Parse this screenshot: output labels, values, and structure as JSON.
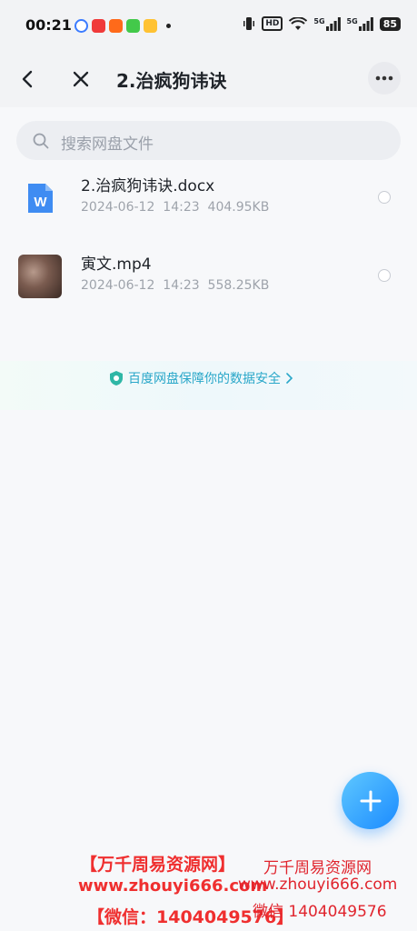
{
  "status_bar": {
    "time": "00:21",
    "hd": "HD",
    "net1": "5G",
    "net2": "5G",
    "battery": "85"
  },
  "navbar": {
    "title": "2.治疯狗讳诀"
  },
  "search": {
    "placeholder": "搜索网盘文件"
  },
  "files": [
    {
      "name": "2.治疯狗讳诀.docx",
      "date": "2024-06-12",
      "time": "14:23",
      "size": "404.95KB",
      "icon": "word-doc-icon"
    },
    {
      "name": "寅文.mp4",
      "date": "2024-06-12",
      "time": "14:23",
      "size": "558.25KB",
      "icon": "video-thumbnail"
    }
  ],
  "banner": {
    "text": "百度网盘保障你的数据安全"
  },
  "watermark": {
    "line1": "【万千周易资源网】",
    "line2": "www.zhouyi666.com",
    "line3": "【微信：1404049576】",
    "r_line1": "万千周易资源网",
    "r_line2": "www.zhouyi666.com",
    "r_line3": "微信 1404049576"
  },
  "colors": {
    "accent": "#1b8bff",
    "word_blue": "#3f8cf2",
    "banner_text": "#2aa7c9",
    "watermark_red": "#ef2f2f"
  }
}
